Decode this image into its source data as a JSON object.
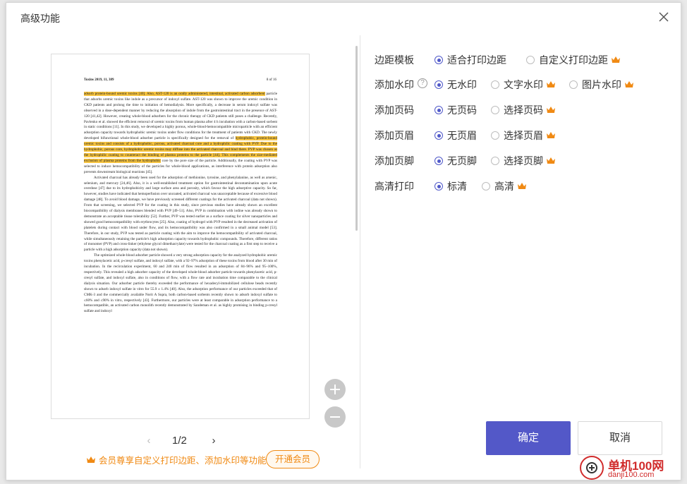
{
  "dialog": {
    "title": "高级功能"
  },
  "preview": {
    "header_left": "Toxins 2019, 11, 389",
    "header_right": "8 of 16",
    "paragraphs": [
      {
        "segments": [
          {
            "t": "adsorb protein-bound uremic toxins [40]. Also, AST-120 is an orally administered, intestinal, activated carbon adsorbent",
            "h": true
          },
          {
            "t": " particle that adsorbs uremic toxins like indole as a precursor of indoxyl sulfate. AST-120 was shown to improve the uremic condition in CKD patients and prolong the time to initiation of hemodialysis. More specifically, a decrease in serum indoxyl sulfate was observed in a dose-dependent manner by reducing the absorption of indole from the gastrointestinal tract in the presence of AST-120 [41,42]. However, creating whole-blood adsorbers for the chronic therapy of CKD patients still poses a challenge. Recently, Pavlenko et al. showed the efficient removal of uremic toxins from human plasma after 4 h incubation with a carbon-based sorbent in static conditions [11]. In this study, we developed a highly porous, whole-blood-hemocompatible microparticle with an efficient adsorption capacity towards hydrophobic uremic toxins under flow conditions for the treatment of patients with CKD. The newly developed bifunctional whole-blood adsorber particle is specifically designed for the removal of ",
            "h": false
          },
          {
            "t": "hydrophobic, protein-bound uremic toxins and consists of a hydrophobic, porous, activated charcoal core and a hydrophilic coating with PVP. Due to the hydrophobic, porous core, hydrophobic uremic toxins may diffuse into the activated charcoal and bind there. PVP was chosen as the hydrophilic coating to counteract the binding of plasma proteins to the particle [44]. This complements the size-mediated exclusion of plasma proteins from the hydrophobic",
            "h": true
          },
          {
            "t": " core by the pore size of the particle. Additionally, the coating with PVP was selected to induce hemocompatibility of the particles for whole-blood applications, as interference with protein adsorption also prevents downstream biological reactions [45].",
            "h": false
          }
        ],
        "indent": false
      },
      {
        "segments": [
          {
            "t": "Activated charcoal has already been used for the adsorption of methionine, tyrosine, and phenylalanine, as well as arsenic, selenium, and mercury [24,46]. Also, it is a well-established treatment option for gastrointestinal decontamination upon acute overdose [47] due to its hydrophobicity and large surface area and porosity, which favour the high adsorptive capacity. So far, however, studies have indicated that hemoperfusion over uncoated, activated charcoal was unacceptable because of excessive blood damage [48]. To avoid blood damage, we have previously screened different coatings for the activated charcoal (data not shown). From that screening, we selected PVP for the coating in this study, since previous studies have already shown an excellent biocompatibility of dialysis membranes blended with PVP [49–51]. Also, PVP in combination with iodine was already shown to demonstrate an acceptable tissue tolerability [52]. Further, PVP was tested earlier as a surface coating for silver nanoparticles and showed good hemocompatibility with erythrocytes [25]. Also, coating of hydrogel with PVP resulted in the decreased activation of platelets during contact with blood under flow, and its hemocompatibility was also confirmed in a small animal model [53]. Therefore, in our study, PVP was tested as particle coating with the aim to improve the hemocompatibility of activated charcoal, while simultaneously retaining the particle's high adsorption capacity towards hydrophobic compounds. Therefore, different ratios of monomer (PVP) and cross-linker (ethylene glycol dimethacrylate) were tested for the charcoal coating as a first step to receive a particle with a high adsorption capacity (data not shown).",
            "h": false
          }
        ],
        "indent": true
      },
      {
        "segments": [
          {
            "t": "The optimized whole-blood adsorber particle showed a very strong adsorption capacity for the analyzed hydrophobic uremic toxins phenylacetic acid, p-cresyl sulfate, and indoxyl sulfate, with a 92–97% adsorption of these toxins from blood after 30 min of incubation. In the recirculation experiment, 60 and 240 min of flow resulted in an adsorption of 84–96% and 95–100%, respectively. This revealed a high adsorber capacity of the developed whole-blood adsorber particle towards phenylacetic acid, p-cresyl sulfate, and indoxyl sulfate, also in conditions of flow, with a flow rate and incubation time comparable to the clinical dialysis situation. Our adsorber particle thereby exceeded the performance of hexadecyl-immobilized cellulose beads recently shown to adsorb indoxyl sulfate in vitro for 55.9 ± 1.4% [40]. Also, the adsorption performance of our particles exceeded that of CMK-3 and the commercially available Norit A Supra, both carbon-based sorbents recently shown to adsorb indoxyl sulfate to ≤60% and ≤90% in vitro, respectively [43]. Furthermore, our particles were at least comparable in adsorption performance to a hemocompatible, an activated carbon monolith recently demonstrated by Sandeman et al. as highly promising in binding p-cresyl sulfate and indoxyl",
            "h": false
          }
        ],
        "indent": true
      }
    ],
    "zoom_in_icon": "plus-circle-icon",
    "zoom_out_icon": "minus-circle-icon"
  },
  "pager": {
    "prev": "‹",
    "current": "1/2",
    "next": "›"
  },
  "promo": {
    "text": "会员尊享自定义打印边距、添加水印等功能",
    "button": "开通会员",
    "color": "#f08a14"
  },
  "options": [
    {
      "label": "边距模板",
      "help": false,
      "choices": [
        {
          "text": "适合打印边距",
          "checked": true,
          "vip": false
        },
        {
          "text": "自定义打印边距",
          "checked": false,
          "vip": true
        }
      ]
    },
    {
      "label": "添加水印",
      "help": true,
      "choices": [
        {
          "text": "无水印",
          "checked": true,
          "vip": false
        },
        {
          "text": "文字水印",
          "checked": false,
          "vip": true
        },
        {
          "text": "图片水印",
          "checked": false,
          "vip": true
        }
      ]
    },
    {
      "label": "添加页码",
      "help": false,
      "choices": [
        {
          "text": "无页码",
          "checked": true,
          "vip": false
        },
        {
          "text": "选择页码",
          "checked": false,
          "vip": true
        }
      ]
    },
    {
      "label": "添加页眉",
      "help": false,
      "choices": [
        {
          "text": "无页眉",
          "checked": true,
          "vip": false
        },
        {
          "text": "选择页眉",
          "checked": false,
          "vip": true
        }
      ]
    },
    {
      "label": "添加页脚",
      "help": false,
      "choices": [
        {
          "text": "无页脚",
          "checked": true,
          "vip": false
        },
        {
          "text": "选择页脚",
          "checked": false,
          "vip": true
        }
      ]
    },
    {
      "label": "高清打印",
      "help": false,
      "choices": [
        {
          "text": "标清",
          "checked": true,
          "vip": false
        },
        {
          "text": "高清",
          "checked": false,
          "vip": true
        }
      ]
    }
  ],
  "help_glyph": "?",
  "buttons": {
    "ok": "确定",
    "cancel": "取消"
  },
  "watermark": {
    "line1": "单机100网",
    "line2": "danji100.com"
  },
  "colors": {
    "accent": "#5358c8",
    "vip": "#f08a14",
    "highlight": "#f7c43f"
  }
}
